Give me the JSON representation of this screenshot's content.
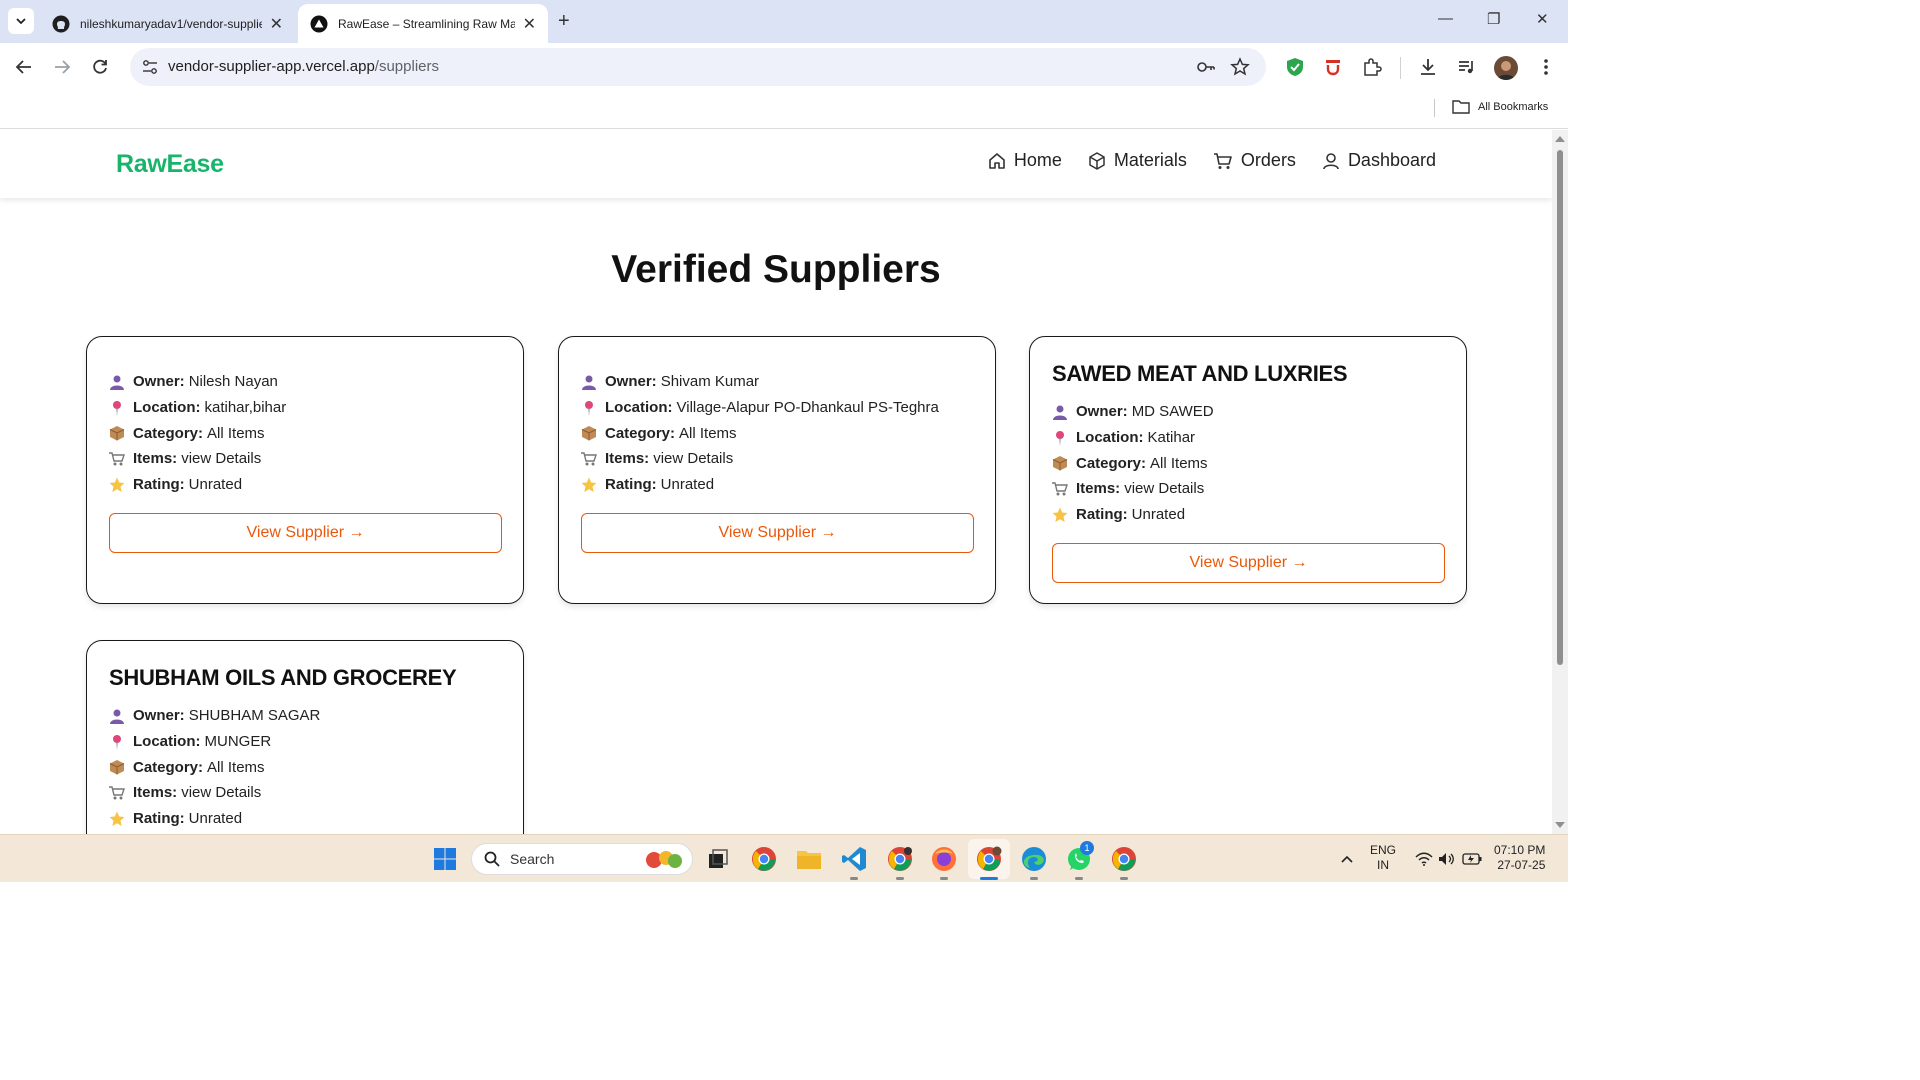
{
  "browser": {
    "tabs": [
      {
        "title": "nileshkumaryadav1/vendor-supplie",
        "active": false
      },
      {
        "title": "RawEase – Streamlining Raw Mate",
        "active": true
      }
    ],
    "url_host": "vendor-supplier-app.vercel.app",
    "url_path": "/suppliers",
    "bookmarks_label": "All Bookmarks"
  },
  "site": {
    "logo": "RawEase",
    "nav": [
      "Home",
      "Materials",
      "Orders",
      "Dashboard"
    ],
    "page_title": "Verified Suppliers"
  },
  "labels": {
    "owner": "Owner:",
    "location": "Location:",
    "category": "Category:",
    "items": "Items:",
    "rating": "Rating:",
    "view_button": "View Supplier →"
  },
  "suppliers": [
    {
      "name": "",
      "owner": "Nilesh Nayan",
      "location": "katihar,bihar",
      "category": "All Items",
      "items": "view Details",
      "rating": "Unrated"
    },
    {
      "name": "",
      "owner": "Shivam Kumar",
      "location": "Village-Alapur PO-Dhankaul PS-Teghra",
      "category": "All Items",
      "items": "view Details",
      "rating": "Unrated"
    },
    {
      "name": "SAWED MEAT AND LUXRIES",
      "owner": "MD SAWED",
      "location": "Katihar",
      "category": "All Items",
      "items": "view Details",
      "rating": "Unrated"
    },
    {
      "name": "SHUBHAM OILS AND GROCEREY",
      "owner": "SHUBHAM SAGAR",
      "location": "MUNGER",
      "category": "All Items",
      "items": "view Details",
      "rating": "Unrated"
    }
  ],
  "taskbar": {
    "search_label": "Search",
    "lang_top": "ENG",
    "lang_bottom": "IN",
    "time": "07:10 PM",
    "date": "27-07-25",
    "whatsapp_badge": "1"
  },
  "colors": {
    "brand_green": "#19b46b",
    "accent_orange": "#ea580c",
    "tabstrip": "#dce3f5",
    "taskbar": "#f3e7d8"
  },
  "icons": [
    "chevron-down-icon",
    "github-icon",
    "vercel-icon",
    "close-icon",
    "plus-icon",
    "back-icon",
    "forward-icon",
    "reload-icon",
    "site-settings-icon",
    "key-icon",
    "star-icon",
    "shield-extension-icon",
    "extensions-icon",
    "download-icon",
    "media-icon",
    "profile-avatar",
    "menu-dots-icon",
    "folder-icon",
    "home-icon",
    "box-icon",
    "cart-icon",
    "user-icon",
    "person-icon",
    "pin-icon",
    "package-icon",
    "trolley-icon",
    "rating-star-icon",
    "windows-start-icon",
    "search-icon"
  ]
}
